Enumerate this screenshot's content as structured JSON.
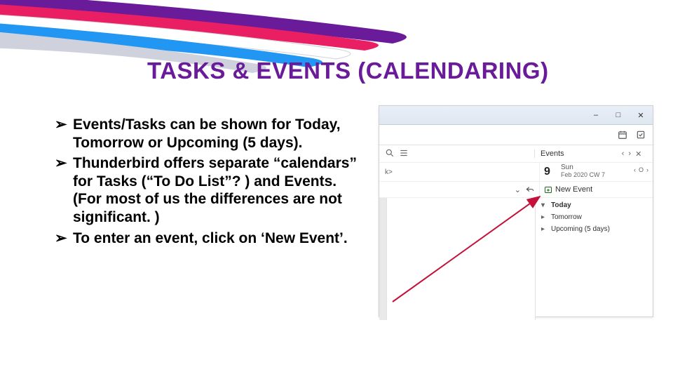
{
  "title": "TASKS & EVENTS (CALENDARING)",
  "bullets": [
    "Events/Tasks can be shown for Today, Tomorrow or Upcoming (5 days).",
    "Thunderbird offers separate “calendars” for Tasks (“To Do List”? ) and Events.  (For most of us the differences are not significant. )",
    "To enter an event, click on ‘New Event’."
  ],
  "panel": {
    "window_controls": {
      "min": "–",
      "max": "□",
      "close": "✕"
    },
    "events_tab": "Events",
    "inbox_snippet": "k>",
    "day_number": "9",
    "day_name": "Sun",
    "day_meta": "Feb 2020  CW 7",
    "chevron_down": "⌄",
    "new_event": "New Event",
    "sections": [
      {
        "label": "Today",
        "expanded": true
      },
      {
        "label": "Tomorrow",
        "expanded": false
      },
      {
        "label": "Upcoming (5 days)",
        "expanded": false
      }
    ],
    "nav": {
      "prev": "‹",
      "next": "›",
      "close": "✕",
      "today": "O"
    }
  },
  "chevron": "➢"
}
